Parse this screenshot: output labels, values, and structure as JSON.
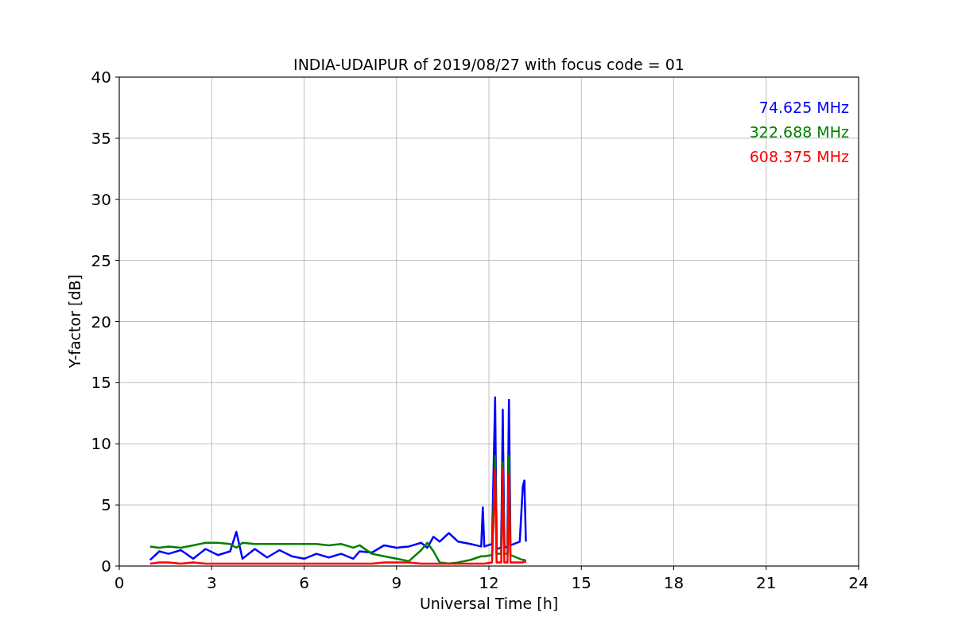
{
  "chart_data": {
    "type": "line",
    "title": "INDIA-UDAIPUR of 2019/08/27 with focus code = 01",
    "xlabel": "Universal Time [h]",
    "ylabel": "Y-factor [dB]",
    "x": [
      1.0,
      1.3,
      1.6,
      2.0,
      2.4,
      2.8,
      3.2,
      3.6,
      3.8,
      4.0,
      4.4,
      4.8,
      5.2,
      5.6,
      6.0,
      6.4,
      6.8,
      7.2,
      7.6,
      7.8,
      8.2,
      8.6,
      9.0,
      9.4,
      9.8,
      10.0,
      10.2,
      10.4,
      10.7,
      11.0,
      11.4,
      11.75,
      11.8,
      11.85,
      12.1,
      12.2,
      12.25,
      12.4,
      12.45,
      12.5,
      12.6,
      12.65,
      12.7,
      13.0,
      13.1,
      13.15,
      13.2
    ],
    "series": [
      {
        "name": "74.625 MHz",
        "color": "#0000ff",
        "values": [
          0.5,
          1.2,
          1.0,
          1.3,
          0.6,
          1.4,
          0.9,
          1.2,
          2.8,
          0.6,
          1.4,
          0.7,
          1.3,
          0.8,
          0.6,
          1.0,
          0.7,
          1.0,
          0.6,
          1.2,
          1.1,
          1.7,
          1.5,
          1.6,
          1.9,
          1.5,
          2.4,
          2.0,
          2.7,
          2.0,
          1.8,
          1.6,
          4.8,
          1.6,
          1.8,
          13.8,
          1.4,
          1.5,
          12.8,
          1.5,
          1.6,
          13.6,
          1.7,
          2.0,
          6.5,
          7.0,
          2.0
        ]
      },
      {
        "name": "322.688 MHz",
        "color": "#008000",
        "values": [
          1.6,
          1.5,
          1.6,
          1.5,
          1.7,
          1.9,
          1.9,
          1.8,
          1.5,
          1.9,
          1.8,
          1.8,
          1.8,
          1.8,
          1.8,
          1.8,
          1.7,
          1.8,
          1.5,
          1.7,
          1.0,
          0.8,
          0.6,
          0.4,
          1.3,
          1.9,
          1.2,
          0.3,
          0.2,
          0.3,
          0.5,
          0.8,
          0.8,
          0.8,
          0.9,
          9.0,
          1.0,
          1.0,
          8.5,
          1.0,
          1.0,
          9.0,
          0.9,
          0.6,
          0.5,
          0.5,
          0.4
        ]
      },
      {
        "name": "608.375 MHz",
        "color": "#ff0000",
        "values": [
          0.2,
          0.3,
          0.3,
          0.2,
          0.3,
          0.2,
          0.2,
          0.2,
          0.2,
          0.2,
          0.2,
          0.2,
          0.2,
          0.2,
          0.2,
          0.2,
          0.2,
          0.2,
          0.2,
          0.2,
          0.2,
          0.3,
          0.3,
          0.3,
          0.2,
          0.2,
          0.2,
          0.2,
          0.2,
          0.2,
          0.2,
          0.2,
          0.2,
          0.2,
          0.3,
          8.0,
          0.3,
          0.3,
          8.0,
          0.3,
          0.3,
          7.5,
          0.3,
          0.3,
          0.3,
          0.4,
          0.3
        ]
      }
    ],
    "grid": true,
    "xlim": [
      0,
      24
    ],
    "ylim": [
      0,
      40
    ],
    "xticks": [
      0,
      3,
      6,
      9,
      12,
      15,
      18,
      21,
      24
    ],
    "yticks": [
      0,
      5,
      10,
      15,
      20,
      25,
      30,
      35,
      40
    ]
  }
}
